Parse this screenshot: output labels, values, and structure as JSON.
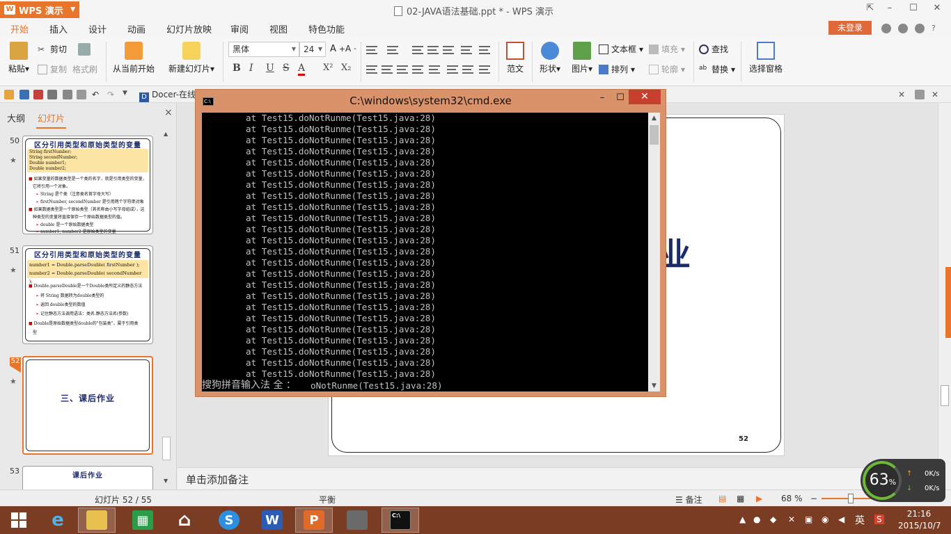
{
  "app": {
    "name": "WPS 演示",
    "logo": "W",
    "doc_title": "02-JAVA语法基础.ppt * - WPS 演示"
  },
  "ribbon_tabs": [
    "开始",
    "插入",
    "设计",
    "动画",
    "幻灯片放映",
    "审阅",
    "视图",
    "特色功能"
  ],
  "login_label": "未登录",
  "ribbon": {
    "paste": "粘贴",
    "cut": "剪切",
    "copy": "复制",
    "format_painter": "格式刷",
    "from_current": "从当前开始",
    "new_slide": "新建幻灯片",
    "font_name": "黑体",
    "font_size": "24",
    "bold": "B",
    "italic": "I",
    "underline": "U",
    "strike": "S",
    "font_color": "A",
    "superscript": "X²",
    "subscript": "X₂",
    "template": "范文",
    "shape": "形状",
    "picture": "图片",
    "textbox": "文本框",
    "arrange": "排列",
    "fill": "填充",
    "outline": "轮廓",
    "find": "查找",
    "replace": "替换",
    "selection_pane": "选择窗格"
  },
  "quick_access": {
    "docer_tab": "Docer-在线"
  },
  "left_panel": {
    "tab_outline": "大纲",
    "tab_slides": "幻灯片",
    "close": "×",
    "slides": [
      {
        "num": "50",
        "title": "区分引用类型和原始类型的变量",
        "code": [
          "String firstNumber;",
          "String secondNumber;",
          "Double number1;",
          "Double number2;"
        ],
        "lines": [
          {
            "kind": "b",
            "text": "如果变量的数据类型是一个类的名字，就是引用类型的变量，"
          },
          {
            "kind": "p",
            "text": "它将引用一个对象。"
          },
          {
            "kind": "s",
            "text": "String 是个类（注意类名首字母大写）"
          },
          {
            "kind": "s",
            "text": "firstNumber, secondNumber 是引用两个字符串对象"
          },
          {
            "kind": "b",
            "text": "如果数据类型是一个原始类型（其名称由小写字母组成），这"
          },
          {
            "kind": "p",
            "text": "种类型的变量将直接保存一个原始数据类型的值。"
          },
          {
            "kind": "s",
            "text": "double 是一个原始数据类型"
          },
          {
            "kind": "s",
            "text": "number1, number2 是原始类型的变量"
          }
        ]
      },
      {
        "num": "51",
        "title": "区分引用类型和原始类型的变量",
        "code": [
          "number1 = Double.parseDouble( firstNumber );",
          "number2 = Double.parseDouble( secondNumber );"
        ],
        "lines": [
          {
            "kind": "b",
            "text": "Double.parseDouble是一个Double类所定义的静态方法"
          },
          {
            "kind": "s",
            "text": "将 String 数据转为double类型的"
          },
          {
            "kind": "s",
            "text": "返回 double类型的数值"
          },
          {
            "kind": "s",
            "text": "记住静态方法调用语法：类名.静态方法名(参数)"
          },
          {
            "kind": "b",
            "text": "Double是原始数据类型double的\"包装类\"，属于引用类"
          },
          {
            "kind": "p",
            "text": "型"
          }
        ]
      },
      {
        "num": "52",
        "title": "三、课后作业"
      },
      {
        "num": "53",
        "title": "课后作业"
      }
    ]
  },
  "cmd": {
    "title": "C:\\windows\\system32\\cmd.exe",
    "minimize": "–",
    "maximize": "☐",
    "close": "✕",
    "repeat_line": "at Test15.doNotRunme(Test15.java:28)",
    "repeat_count": 24,
    "ime_text": "搜狗拼音输入法 全 ：",
    "last_line_tail": "oNotRunme(Test15.java:28)"
  },
  "slide": {
    "partial_text": "业",
    "page_number": "52"
  },
  "notes_placeholder": "单击添加备注",
  "status": {
    "slide_counter": "幻灯片 52 / 55",
    "theme": "平衡",
    "notes_label": "备注",
    "zoom": "68 %"
  },
  "speed_widget": {
    "percent": "63",
    "percent_sign": "%",
    "up": "0K/s",
    "down": "0K/s"
  },
  "taskbar": {
    "tray_ime": "英",
    "time": "21:16",
    "date": "2015/10/7"
  },
  "colors": {
    "accent": "#e9752a",
    "cmd_frame": "#d99269",
    "taskbar": "#7a3d24",
    "slide_title": "#1b2a6b"
  }
}
